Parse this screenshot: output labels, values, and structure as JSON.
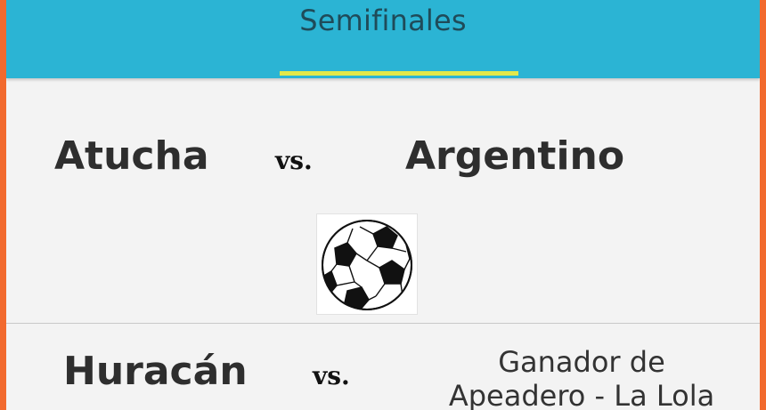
{
  "tabs": {
    "active_label": "Semifinales"
  },
  "matches": [
    {
      "home": "Atucha",
      "vs": "vs.",
      "away": "Argentino"
    },
    {
      "home": "Huracán",
      "vs": "vs.",
      "away": "Ganador de Apeadero  - La Lola"
    }
  ],
  "icons": {
    "ball": "soccer-ball-icon"
  },
  "colors": {
    "header": "#2bb4d4",
    "indicator": "#e3e84a",
    "frame": "#f26a2e"
  }
}
